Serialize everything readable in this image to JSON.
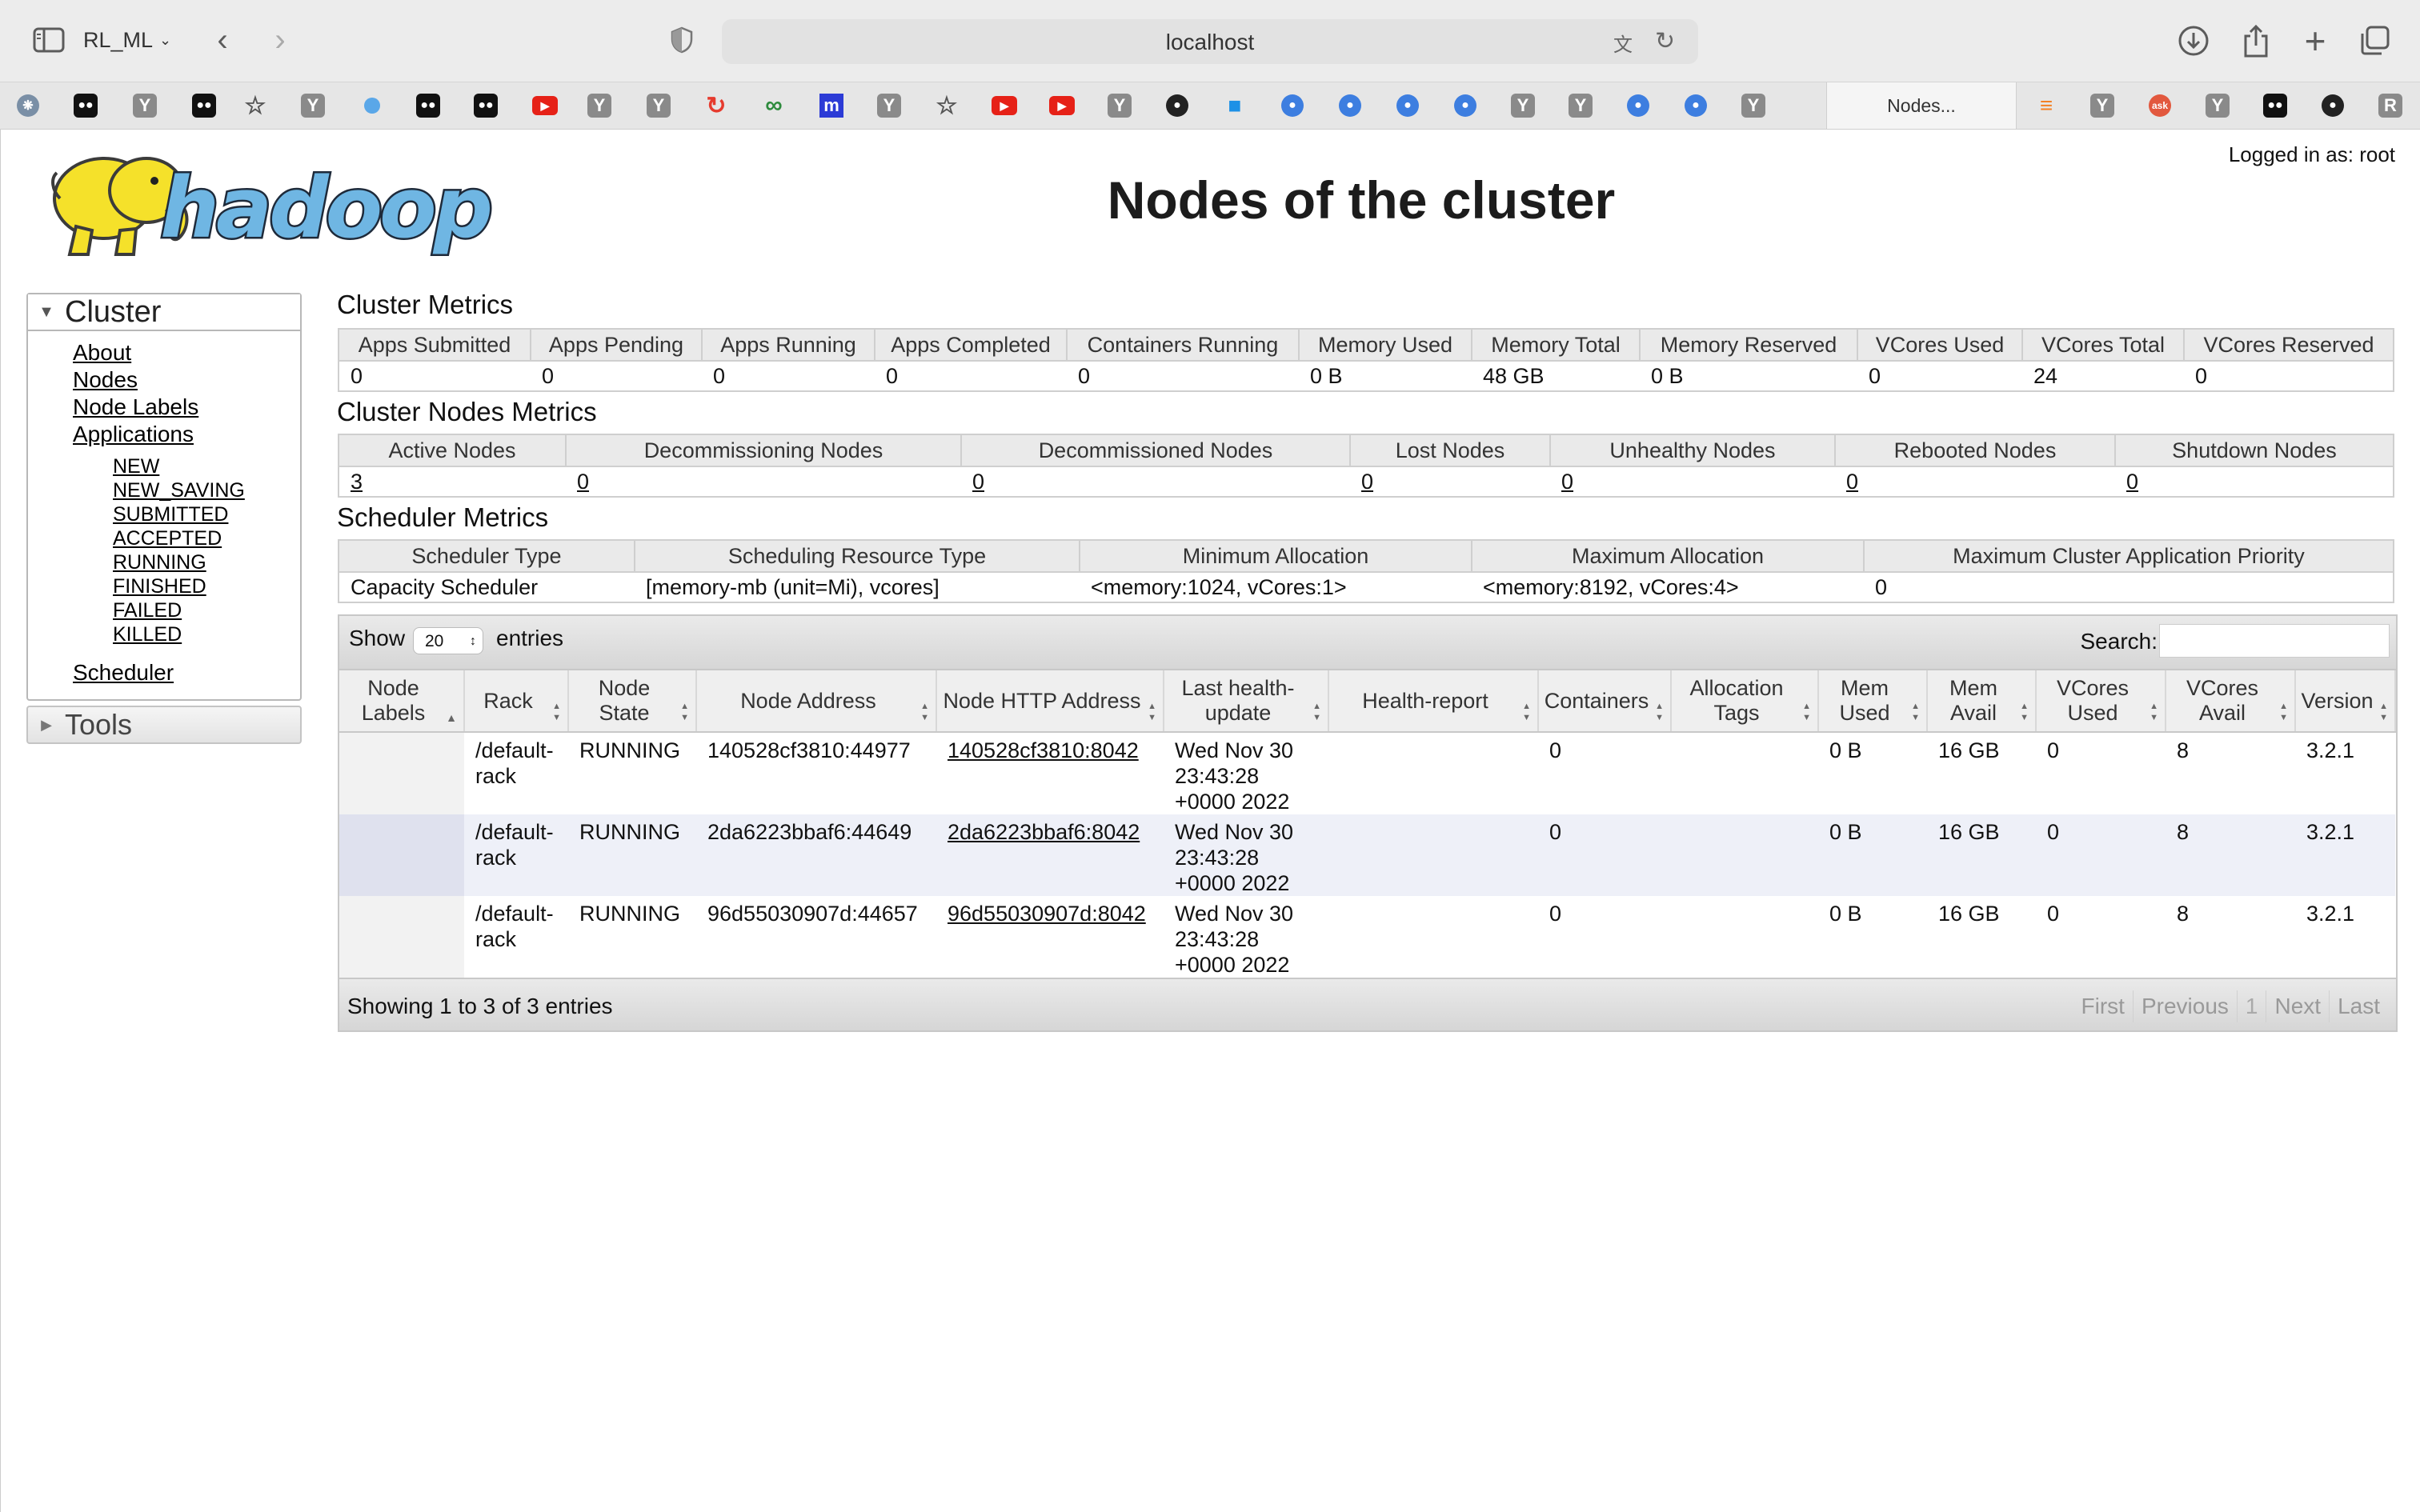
{
  "browser": {
    "profile": "RL_ML",
    "url": "localhost",
    "active_tab": "Nodes...",
    "tab_icons": [
      "openai-icon",
      "medium-icon",
      "ycombinator-icon",
      "medium-icon",
      "star-icon",
      "ycombinator-icon",
      "blue-dot-icon",
      "medium-icon",
      "medium-icon",
      "youtube-icon",
      "ycombinator-icon",
      "ycombinator-icon",
      "refresh-red-icon",
      "infinity-icon",
      "m-icon",
      "ycombinator-icon",
      "star-icon",
      "youtube-icon",
      "youtube-icon",
      "ycombinator-icon",
      "github-icon",
      "docker-icon",
      "blue-circle-icon",
      "blue-circle-icon",
      "blue-circle-icon",
      "blue-circle-icon",
      "ycombinator-icon",
      "ycombinator-icon",
      "blue-circle-icon",
      "blue-circle-icon",
      "ycombinator-icon"
    ],
    "right_tab_icons": [
      "stackoverflow-icon",
      "ycombinator-icon",
      "ask-icon",
      "ycombinator-icon",
      "medium-icon",
      "github-icon",
      "r-icon"
    ]
  },
  "header": {
    "logo_text": "hadoop",
    "title": "Nodes of the cluster",
    "logged_in": "Logged in as: root"
  },
  "nav": {
    "cluster_label": "Cluster",
    "links": [
      "About",
      "Nodes",
      "Node Labels",
      "Applications"
    ],
    "app_states": [
      "NEW",
      "NEW_SAVING",
      "SUBMITTED",
      "ACCEPTED",
      "RUNNING",
      "FINISHED",
      "FAILED",
      "KILLED"
    ],
    "scheduler": "Scheduler",
    "tools_label": "Tools"
  },
  "cluster_metrics": {
    "title": "Cluster Metrics",
    "headers": [
      "Apps Submitted",
      "Apps Pending",
      "Apps Running",
      "Apps Completed",
      "Containers Running",
      "Memory Used",
      "Memory Total",
      "Memory Reserved",
      "VCores Used",
      "VCores Total",
      "VCores Reserved"
    ],
    "values": [
      "0",
      "0",
      "0",
      "0",
      "0",
      "0 B",
      "48 GB",
      "0 B",
      "0",
      "24",
      "0"
    ]
  },
  "node_metrics": {
    "title": "Cluster Nodes Metrics",
    "headers": [
      "Active Nodes",
      "Decommissioning Nodes",
      "Decommissioned Nodes",
      "Lost Nodes",
      "Unhealthy Nodes",
      "Rebooted Nodes",
      "Shutdown Nodes"
    ],
    "values": [
      "3",
      "0",
      "0",
      "0",
      "0",
      "0",
      "0"
    ]
  },
  "scheduler_metrics": {
    "title": "Scheduler Metrics",
    "headers": [
      "Scheduler Type",
      "Scheduling Resource Type",
      "Minimum Allocation",
      "Maximum Allocation",
      "Maximum Cluster Application Priority"
    ],
    "values": [
      "Capacity Scheduler",
      "[memory-mb (unit=Mi), vcores]",
      "<memory:1024, vCores:1>",
      "<memory:8192, vCores:4>",
      "0"
    ]
  },
  "nodes_table": {
    "show_label": "Show",
    "page_length": "20",
    "entries_label": "entries",
    "search_label": "Search:",
    "search_value": "",
    "headers": [
      "Node Labels",
      "Rack",
      "Node State",
      "Node Address",
      "Node HTTP Address",
      "Last health-update",
      "Health-report",
      "Containers",
      "Allocation Tags",
      "Mem Used",
      "Mem Avail",
      "VCores Used",
      "VCores Avail",
      "Version"
    ],
    "rows": [
      {
        "labels": "",
        "rack": "/default-rack",
        "state": "RUNNING",
        "address": "140528cf3810:44977",
        "http": "140528cf3810:8042",
        "health_update": "Wed Nov 30 23:43:28 +0000 2022",
        "health_report": "",
        "containers": "0",
        "tags": "",
        "mem_used": "0 B",
        "mem_avail": "16 GB",
        "vcores_used": "0",
        "vcores_avail": "8",
        "version": "3.2.1"
      },
      {
        "labels": "",
        "rack": "/default-rack",
        "state": "RUNNING",
        "address": "2da6223bbaf6:44649",
        "http": "2da6223bbaf6:8042",
        "health_update": "Wed Nov 30 23:43:28 +0000 2022",
        "health_report": "",
        "containers": "0",
        "tags": "",
        "mem_used": "0 B",
        "mem_avail": "16 GB",
        "vcores_used": "0",
        "vcores_avail": "8",
        "version": "3.2.1"
      },
      {
        "labels": "",
        "rack": "/default-rack",
        "state": "RUNNING",
        "address": "96d55030907d:44657",
        "http": "96d55030907d:8042",
        "health_update": "Wed Nov 30 23:43:28 +0000 2022",
        "health_report": "",
        "containers": "0",
        "tags": "",
        "mem_used": "0 B",
        "mem_avail": "16 GB",
        "vcores_used": "0",
        "vcores_avail": "8",
        "version": "3.2.1"
      }
    ],
    "info": "Showing 1 to 3 of 3 entries",
    "pagination": {
      "first": "First",
      "previous": "Previous",
      "page": "1",
      "next": "Next",
      "last": "Last"
    }
  },
  "colors": {
    "logo_blue": "#6fb6e3",
    "logo_yellow": "#f5e12a",
    "link": "#000000"
  }
}
